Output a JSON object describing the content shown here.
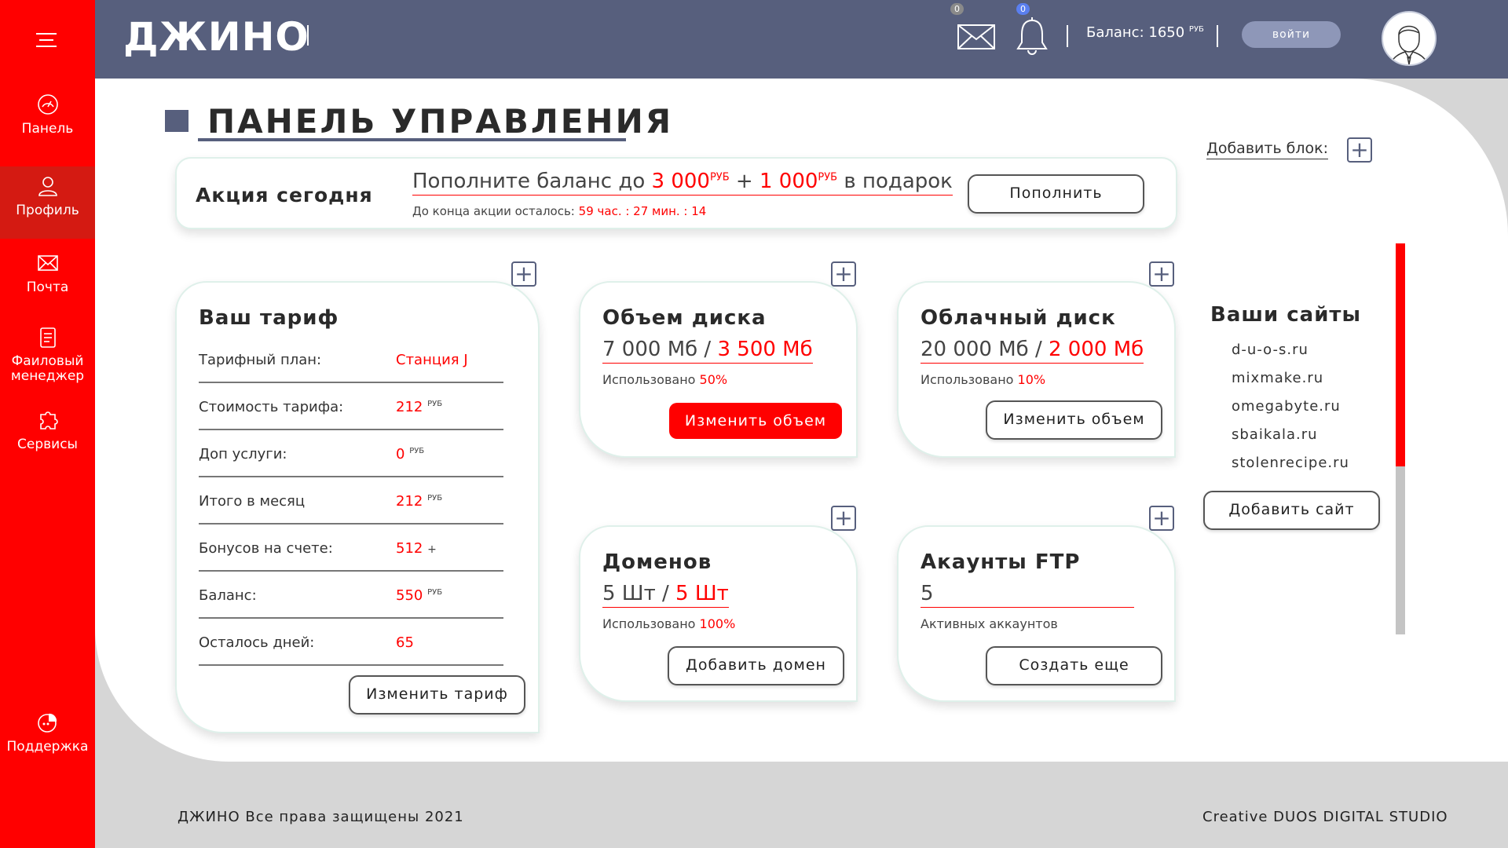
{
  "brand": {
    "logo": "ДЖИНО"
  },
  "colors": {
    "accent": "#ff0000",
    "header": "#575f7d",
    "login": "#8e97b8"
  },
  "sidebar": {
    "items": [
      {
        "label": "Панель",
        "icon": "dashboard-gauge-icon"
      },
      {
        "label": "Профиль",
        "icon": "user-icon",
        "active": true
      },
      {
        "label": "Почта",
        "icon": "mail-icon"
      },
      {
        "label": "Фаиловый",
        "label2": "менеджер",
        "icon": "document-icon"
      },
      {
        "label": "Сервисы",
        "icon": "puzzle-icon"
      },
      {
        "label": "Поддержка",
        "icon": "support-chat-icon"
      }
    ]
  },
  "header": {
    "mail_count": "0",
    "notif_count": "0",
    "balance_label": "Баланс: 1650",
    "balance_unit": "РУБ",
    "login_label": "войти"
  },
  "page": {
    "title": "ПАНЕЛЬ УПРАВЛЕНИЯ",
    "add_block_label": "Добавить блок:"
  },
  "promo": {
    "title": "Акция сегодня",
    "text_prefix": "Пополните баланс до",
    "amount1": "3 000",
    "unit": "РУБ",
    "plus": "+",
    "amount2": "1 000",
    "text_suffix": "в подарок",
    "timer_label": "До конца акции осталось:",
    "timer_value": "59 час. : 27 мин. : 14",
    "button": "Пополнить"
  },
  "tariff": {
    "title": "Ваш тариф",
    "rows": [
      {
        "label": "Тарифный план:",
        "value": "Станция J",
        "unit": ""
      },
      {
        "label": "Стоимость тарифа:",
        "value": "212",
        "unit": "РУБ"
      },
      {
        "label": "Доп услуги:",
        "value": "0",
        "unit": "РУБ"
      },
      {
        "label": "Итого в месяц",
        "value": "212",
        "unit": "РУБ"
      },
      {
        "label": "Бонусов на счете:",
        "value": "512",
        "unit": "+"
      },
      {
        "label": "Баланс:",
        "value": "550",
        "unit": "РУБ"
      },
      {
        "label": "Осталось дней:",
        "value": "65",
        "unit": ""
      }
    ],
    "button": "Изменить тариф"
  },
  "disk": {
    "title": "Объем диска",
    "total": "7 000 Мб /",
    "used": "3 500 Мб",
    "sub_label": "Использовано",
    "sub_value": "50%",
    "button": "Изменить объем"
  },
  "cloud": {
    "title": "Облачный диск",
    "total": "20 000 Мб /",
    "used": "2 000 Мб",
    "sub_label": "Использовано",
    "sub_value": "10%",
    "button": "Изменить объем"
  },
  "domains": {
    "title": "Доменов",
    "total": "5 Шт /",
    "used": "5 Шт",
    "sub_label": "Использовано",
    "sub_value": "100%",
    "button": "Добавить домен"
  },
  "ftp": {
    "title": "Акаунты FTP",
    "value": "5",
    "sub_label": "Активных аккаунтов",
    "button": "Создать еще"
  },
  "sites": {
    "title": "Ваши сайты",
    "items": [
      "d-u-o-s.ru",
      "mixmake.ru",
      "omegabyte.ru",
      "sbaikala.ru",
      "stolenrecipe.ru"
    ],
    "button": "Добавить сайт",
    "scroll_fraction": 0.57
  },
  "footer": {
    "left": "ДЖИНО Все права защищены 2021",
    "right": "Creative DUOS DIGITAL STUDIO"
  }
}
